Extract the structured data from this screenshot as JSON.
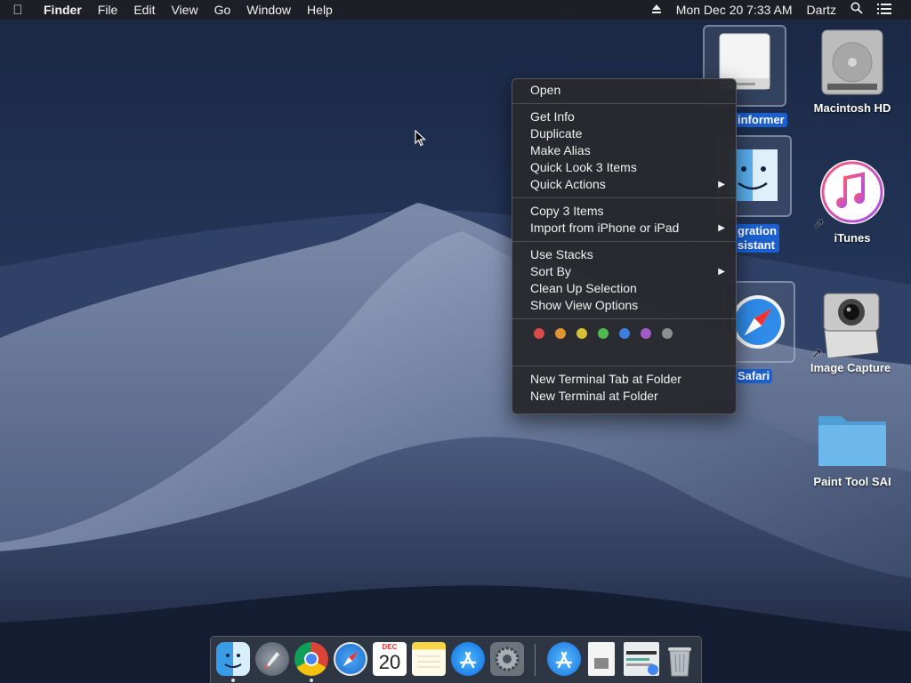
{
  "menubar": {
    "apple_icon": "apple-icon",
    "app_name": "Finder",
    "menus": [
      "File",
      "Edit",
      "View",
      "Go",
      "Window",
      "Help"
    ],
    "datetime": "Mon Dec 20  7:33 AM",
    "user": "Dartz",
    "status_icons": [
      "eject-icon",
      "search-icon",
      "list-icon"
    ]
  },
  "desktop": {
    "icons": [
      {
        "label": "Macintosh HD",
        "icon": "hard-drive-icon"
      },
      {
        "label": "iTunes",
        "icon": "itunes-icon"
      },
      {
        "label": "Image Capture",
        "icon": "image-capture-icon"
      },
      {
        "label": "Paint Tool SAI",
        "icon": "folder-icon"
      }
    ],
    "selected_icons": [
      {
        "label": "informer",
        "icon": "drive-icon"
      },
      {
        "label": "gration\nsistant",
        "icon": "finder-icon"
      },
      {
        "label": "Safari",
        "icon": "safari-icon"
      }
    ]
  },
  "context_menu": {
    "group1": [
      "Open"
    ],
    "group2": [
      "Get Info",
      "Duplicate",
      "Make Alias",
      "Quick Look 3 Items",
      "Quick Actions"
    ],
    "group3": [
      "Copy 3 Items",
      "Import from iPhone or iPad"
    ],
    "group4": [
      "Use Stacks",
      "Sort By",
      "Clean Up Selection",
      "Show View Options"
    ],
    "tag_colors": [
      "#d94a4a",
      "#e0952f",
      "#d6c035",
      "#4dbb4d",
      "#3d7ddb",
      "#a35ac9",
      "#8e8e8e"
    ],
    "group5": [
      "New Terminal Tab at Folder",
      "New Terminal at Folder"
    ],
    "submenu_arrow": "▶"
  },
  "calendar": {
    "month": "DEC",
    "day": "20"
  },
  "dock": {
    "apps": [
      "Finder",
      "Launchpad",
      "Chrome",
      "Safari",
      "Calendar",
      "Notes",
      "App Store",
      "System Preferences",
      "Applications",
      "Documents",
      "Downloads",
      "Trash"
    ]
  }
}
